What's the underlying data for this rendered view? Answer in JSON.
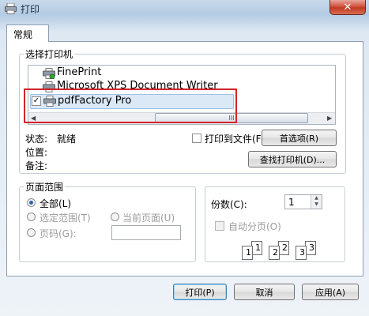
{
  "window": {
    "title": "打印",
    "close_label": "✕"
  },
  "tabs": [
    {
      "label": "常规"
    }
  ],
  "select_printer": {
    "group_title": "选择打印机",
    "printers": [
      {
        "name": "FinePrint"
      },
      {
        "name": "Microsoft XPS Document Writer"
      },
      {
        "name": "pdfFactory Pro",
        "selected": true,
        "checked": true
      }
    ],
    "scroll_thumb_grip": "III",
    "status_label": "状态:",
    "status_value": "就绪",
    "location_label": "位置:",
    "comment_label": "备注:",
    "print_to_file_label": "打印到文件(F)",
    "print_to_file_checked": false,
    "preferences_button": "首选项(R)",
    "find_printer_button": "查找打印机(D)..."
  },
  "page_range": {
    "group_title": "页面范围",
    "all_label": "全部(L)",
    "selection_label": "选定范围(T)",
    "current_page_label": "当前页面(U)",
    "pages_label": "页码(G):",
    "pages_value": "",
    "selected": "all"
  },
  "copies": {
    "label": "份数(C):",
    "value": "1",
    "collate_label": "自动分页(O)",
    "collate_checked": false,
    "collate_digits": [
      "1",
      "1",
      "2",
      "2",
      "3",
      "3"
    ]
  },
  "footer": {
    "print_button": "打印(P)",
    "cancel_button": "取消",
    "apply_button": "应用(A)"
  },
  "colors": {
    "accent": "#2a62b5",
    "highlight_box": "#d1242a",
    "selected_row": "#dbe8f6"
  }
}
